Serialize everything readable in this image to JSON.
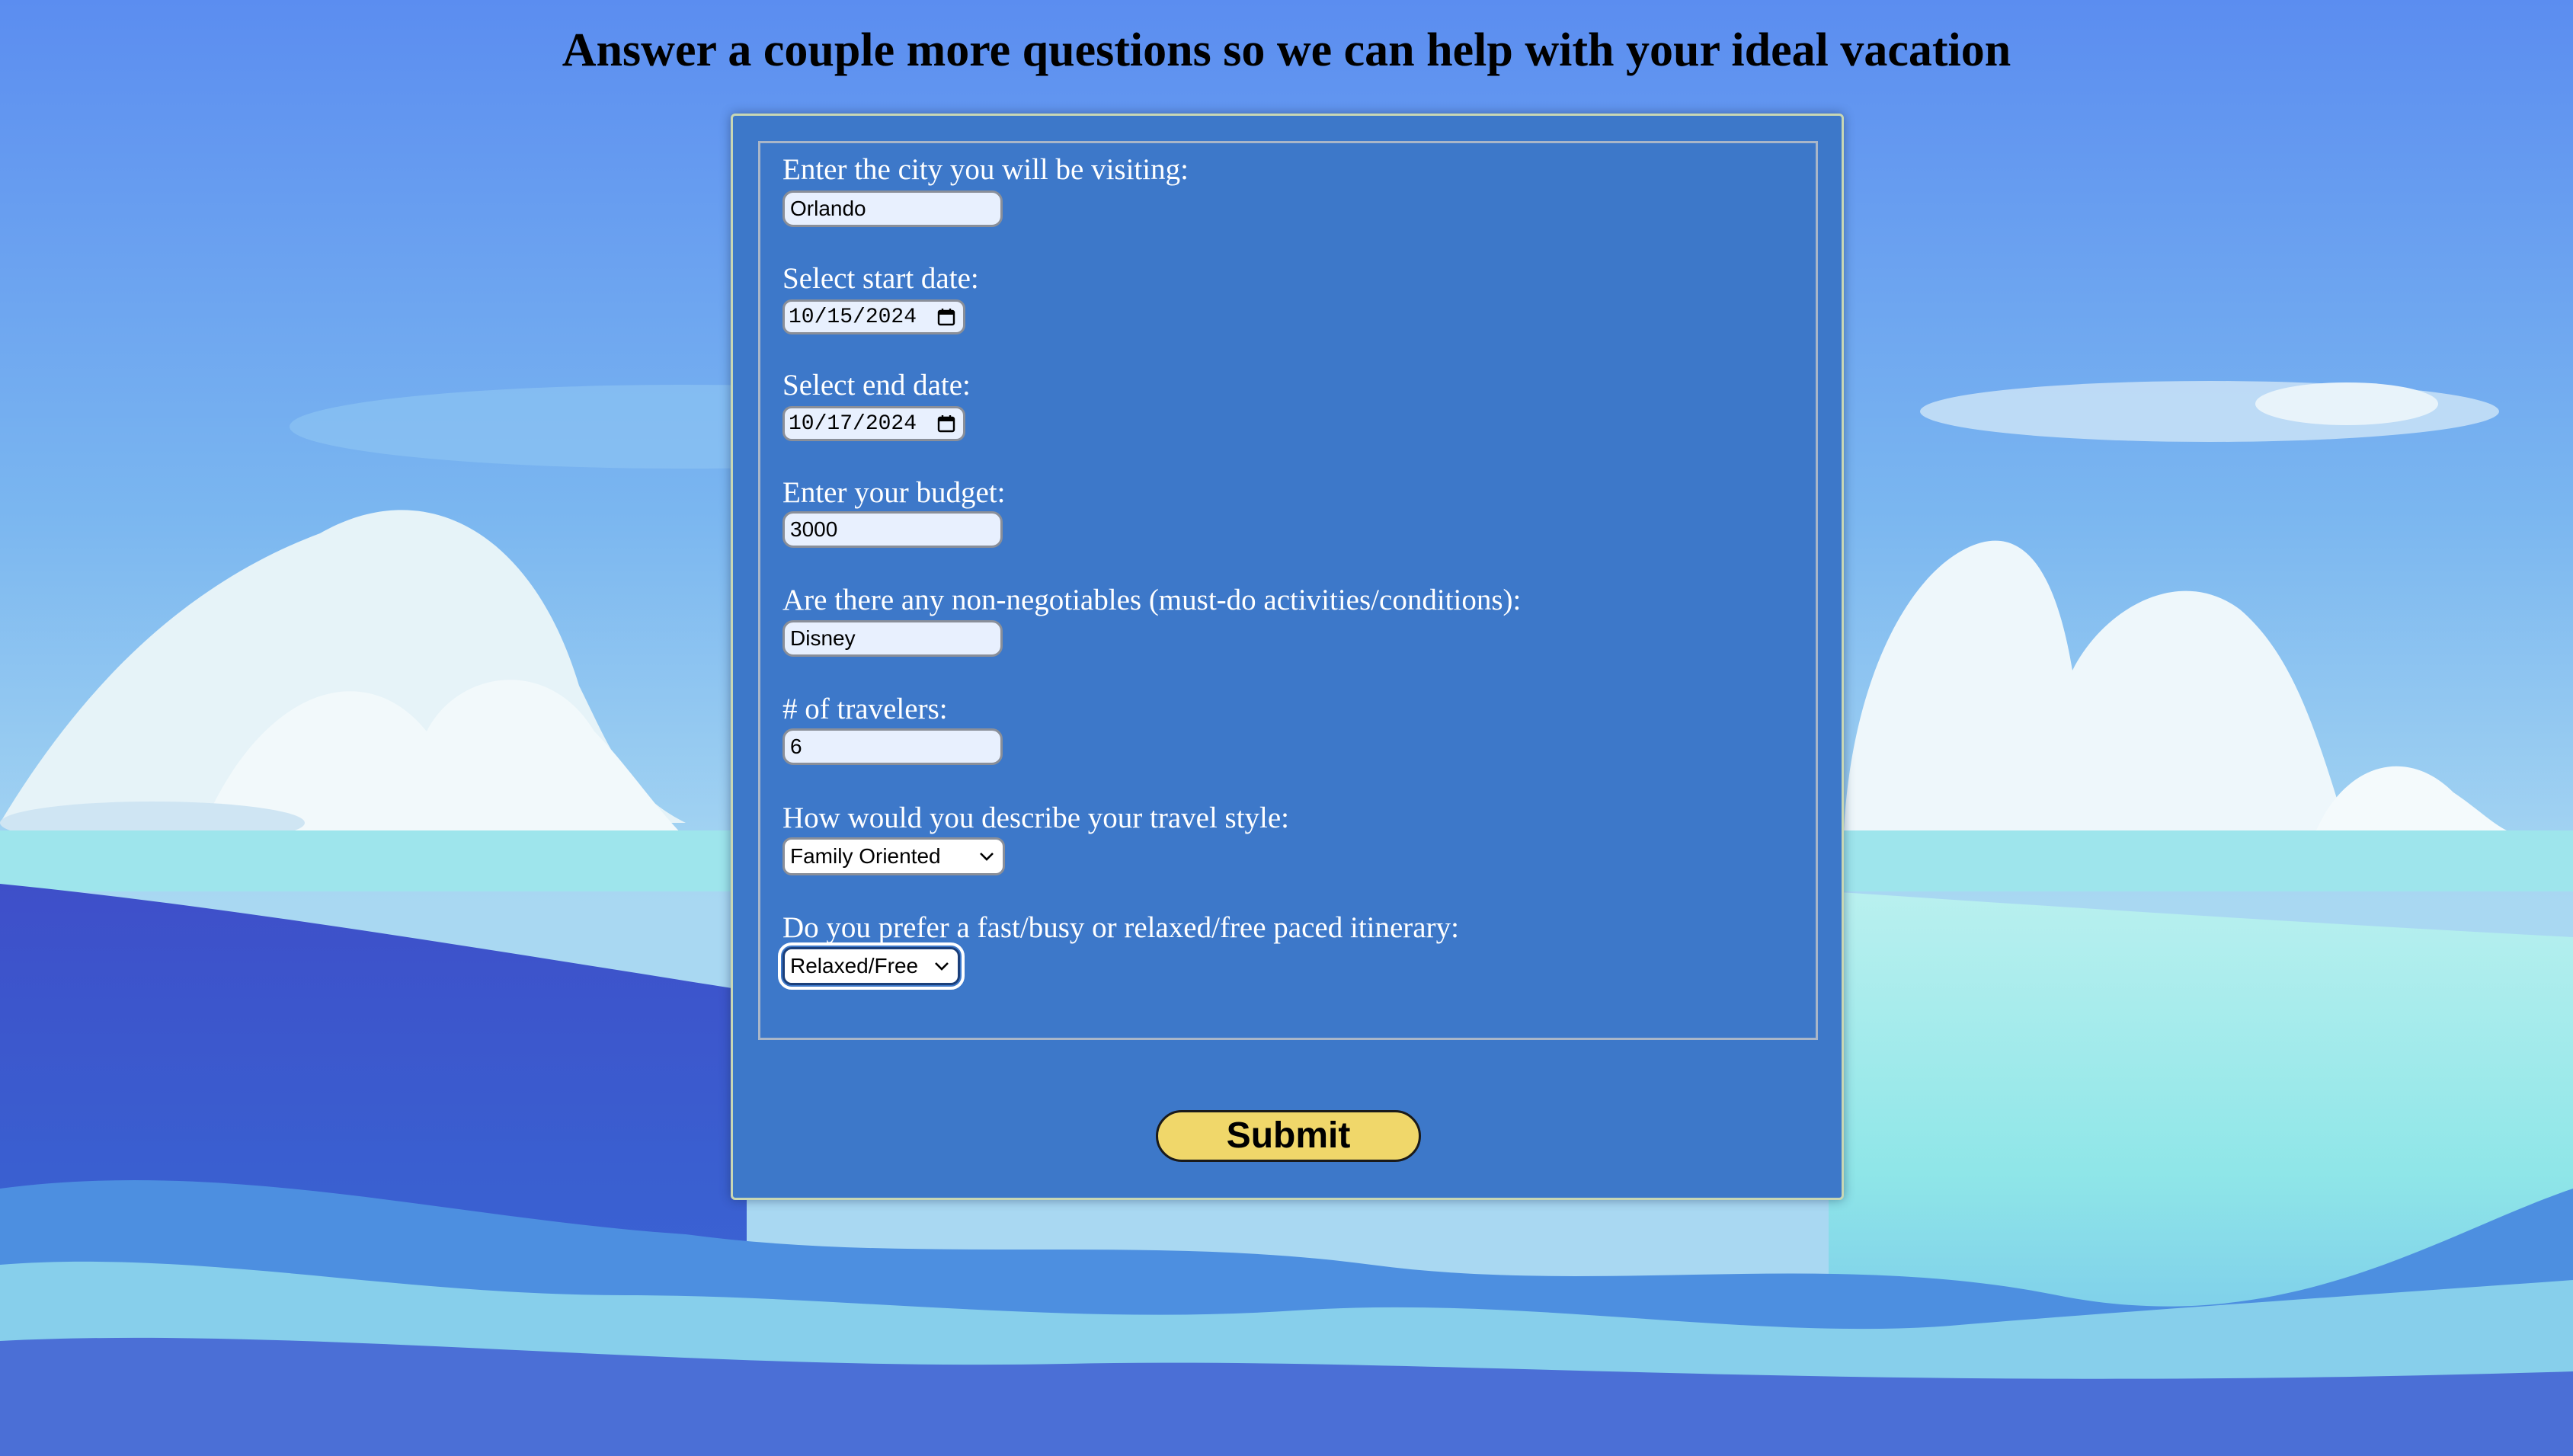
{
  "page": {
    "title": "Answer a couple more questions so we can help with your ideal vacation"
  },
  "form": {
    "city": {
      "label": "Enter the city you will be visiting:",
      "value": "Orlando"
    },
    "start_date": {
      "label": "Select start date:",
      "value": "10/15/2024"
    },
    "end_date": {
      "label": "Select end date:",
      "value": "10/17/2024"
    },
    "budget": {
      "label": "Enter your budget:",
      "value": "3000"
    },
    "non_negotiables": {
      "label": "Are there any non-negotiables (must-do activities/conditions):",
      "value": "Disney"
    },
    "travelers": {
      "label": "# of travelers:",
      "value": "6"
    },
    "travel_style": {
      "label": "How would you describe your travel style:",
      "selected": "Family Oriented"
    },
    "pace": {
      "label": "Do you prefer a fast/busy or relaxed/free paced itinerary:",
      "selected": "Relaxed/Free"
    },
    "submit_label": "Submit"
  },
  "icons": {
    "calendar": "calendar-icon",
    "dropdown": "chevron-down-icon"
  },
  "colors": {
    "panel": "#3d78c9",
    "submit": "#f0d76a",
    "input_fill": "#e8f0fe",
    "label_text": "#ffffff"
  }
}
